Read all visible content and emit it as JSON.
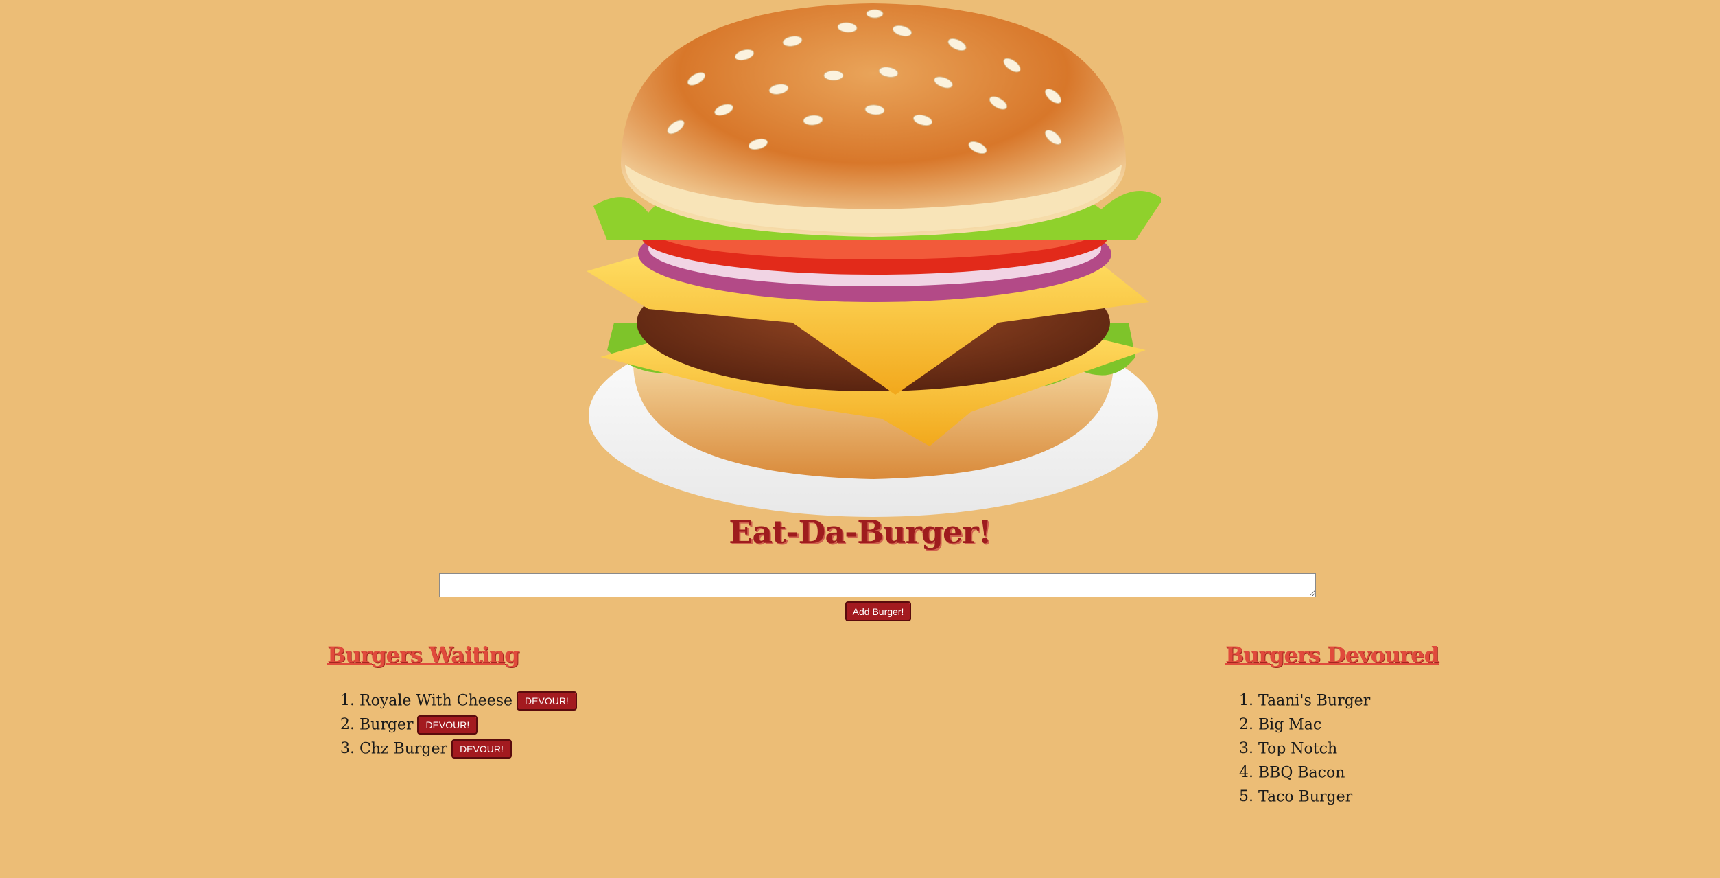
{
  "page": {
    "title": "Eat-Da-Burger!"
  },
  "form": {
    "input_value": "",
    "submit_label": "Add Burger!"
  },
  "waiting": {
    "heading": "Burgers Waiting",
    "button_label": "DEVOUR!",
    "items": [
      {
        "name": "Royale With Cheese"
      },
      {
        "name": "Burger"
      },
      {
        "name": "Chz Burger"
      }
    ]
  },
  "devoured": {
    "heading": "Burgers Devoured",
    "items": [
      {
        "name": "Taani's Burger"
      },
      {
        "name": "Big Mac"
      },
      {
        "name": "Top Notch"
      },
      {
        "name": "BBQ Bacon"
      },
      {
        "name": "Taco Burger"
      }
    ]
  },
  "colors": {
    "background": "#ecbd76",
    "title": "#9e1c1e",
    "section_heading": "#e04a3c",
    "button": "#a31a1f"
  },
  "images": {
    "hero": "hamburger-illustration"
  }
}
